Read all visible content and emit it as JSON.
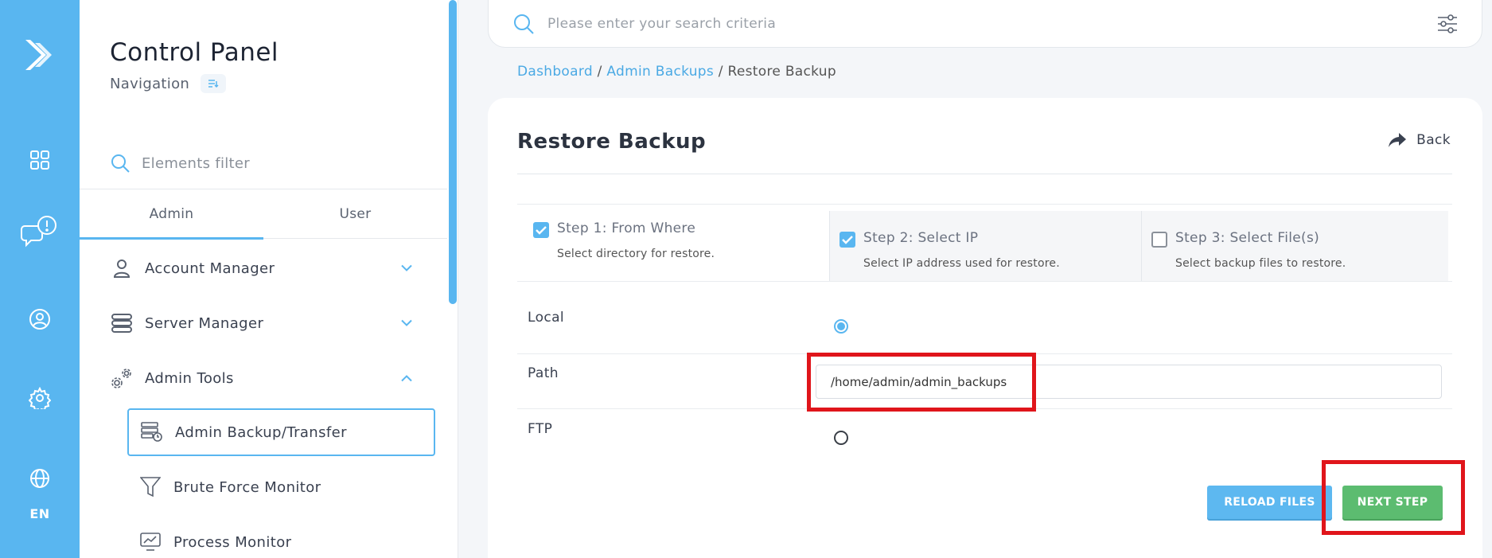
{
  "rail": {
    "language": "EN",
    "icons": [
      "logo-icon",
      "dashboard-grid-icon",
      "notifications-icon",
      "user-icon",
      "settings-icon",
      "language-globe-icon"
    ]
  },
  "nav": {
    "title": "Control Panel",
    "subtitle": "Navigation",
    "filter_placeholder": "Elements filter",
    "tabs": [
      {
        "label": "Admin",
        "active": true
      },
      {
        "label": "User",
        "active": false
      }
    ],
    "items": [
      {
        "label": "Account Manager",
        "expanded": false
      },
      {
        "label": "Server Manager",
        "expanded": false
      },
      {
        "label": "Admin Tools",
        "expanded": true
      }
    ],
    "sub_items": [
      {
        "label": "Admin Backup/Transfer",
        "active": true
      },
      {
        "label": "Brute Force Monitor",
        "active": false
      },
      {
        "label": "Process Monitor",
        "active": false
      }
    ]
  },
  "search": {
    "placeholder": "Please enter your search criteria"
  },
  "breadcrumb": {
    "items": [
      "Dashboard",
      "Admin Backups",
      "Restore Backup"
    ],
    "separator": "/"
  },
  "page": {
    "title": "Restore Backup",
    "back_label": "Back"
  },
  "steps": [
    {
      "title": "Step 1: From Where",
      "desc": "Select directory for restore.",
      "checked": true
    },
    {
      "title": "Step 2: Select IP",
      "desc": "Select IP address used for restore.",
      "checked": true
    },
    {
      "title": "Step 3: Select File(s)",
      "desc": "Select backup files to restore.",
      "checked": false
    }
  ],
  "form": {
    "local_label": "Local",
    "local_selected": true,
    "path_label": "Path",
    "path_value": "/home/admin/admin_backups",
    "ftp_label": "FTP",
    "ftp_selected": false
  },
  "buttons": {
    "reload": "RELOAD FILES",
    "next": "NEXT STEP"
  },
  "colors": {
    "accent": "#59b6f0",
    "success": "#5cbc70",
    "highlight": "#e0151b"
  }
}
